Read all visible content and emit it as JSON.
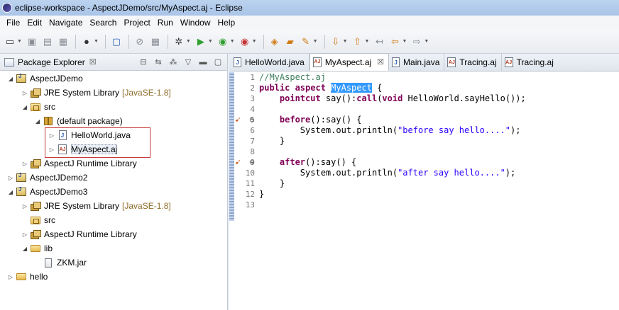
{
  "window": {
    "title": "eclipse-workspace - AspectJDemo/src/MyAspect.aj - Eclipse"
  },
  "menu": {
    "items": [
      "File",
      "Edit",
      "Navigate",
      "Search",
      "Project",
      "Run",
      "Window",
      "Help"
    ]
  },
  "package_explorer": {
    "title": "Package Explorer",
    "close": "☒",
    "tree": [
      {
        "label": "AspectJDemo",
        "decor": "",
        "indent": 0,
        "twisty": "◢",
        "icon": "project"
      },
      {
        "label": "JRE System Library",
        "decor": "[JavaSE-1.8]",
        "indent": 1,
        "twisty": "▷",
        "icon": "library"
      },
      {
        "label": "src",
        "decor": "",
        "indent": 1,
        "twisty": "◢",
        "icon": "srcfolder"
      },
      {
        "label": "(default package)",
        "decor": "",
        "indent": 2,
        "twisty": "◢",
        "icon": "package"
      },
      {
        "label": "HelloWorld.java",
        "decor": "",
        "indent": 3,
        "twisty": "▷",
        "icon": "javafile"
      },
      {
        "label": "MyAspect.aj",
        "decor": "",
        "indent": 3,
        "twisty": "▷",
        "icon": "ajfile"
      },
      {
        "label": "AspectJ Runtime Library",
        "decor": "",
        "indent": 1,
        "twisty": "▷",
        "icon": "library"
      },
      {
        "label": "AspectJDemo2",
        "decor": "",
        "indent": 0,
        "twisty": "▷",
        "icon": "project"
      },
      {
        "label": "AspectJDemo3",
        "decor": "",
        "indent": 0,
        "twisty": "◢",
        "icon": "project"
      },
      {
        "label": "JRE System Library",
        "decor": "[JavaSE-1.8]",
        "indent": 1,
        "twisty": "▷",
        "icon": "library"
      },
      {
        "label": "src",
        "decor": "",
        "indent": 1,
        "twisty": "",
        "icon": "srcfolder"
      },
      {
        "label": "AspectJ Runtime Library",
        "decor": "",
        "indent": 1,
        "twisty": "▷",
        "icon": "library"
      },
      {
        "label": "lib",
        "decor": "",
        "indent": 1,
        "twisty": "◢",
        "icon": "folder"
      },
      {
        "label": "ZKM.jar",
        "decor": "",
        "indent": 2,
        "twisty": "",
        "icon": "jar"
      },
      {
        "label": "hello",
        "decor": "",
        "indent": 0,
        "twisty": "▷",
        "icon": "project"
      }
    ]
  },
  "editor": {
    "tabs": [
      {
        "label": "HelloWorld.java",
        "icon": "J",
        "active": false,
        "close": ""
      },
      {
        "label": "MyAspect.aj",
        "icon": "AJ",
        "active": true,
        "close": "☒"
      },
      {
        "label": "Main.java",
        "icon": "J",
        "active": false,
        "close": ""
      },
      {
        "label": "Tracing.aj",
        "icon": "AJ",
        "active": false,
        "close": ""
      },
      {
        "label": "Tracing.aj",
        "icon": "AJ",
        "active": false,
        "close": ""
      }
    ],
    "line_numbers": [
      "1",
      "2",
      "3",
      "4",
      "5",
      "6",
      "7",
      "8",
      "9",
      "10",
      "11",
      "12",
      "13"
    ],
    "fold_markers": [
      "5⊖",
      "9⊖"
    ],
    "code": {
      "l1": "//MyAspect.aj",
      "l2_kw": "public aspect ",
      "l2_sel": "MyAspect",
      "l2_rest": " {",
      "l3_indent": "    ",
      "l3_kw": "pointcut",
      "l3_a": " say():",
      "l3_kw2": "call",
      "l3_b": "(",
      "l3_kw3": "void",
      "l3_c": " HelloWorld.sayHello());",
      "l4": "",
      "l5_indent": "    ",
      "l5_kw": "before",
      "l5_rest": "():say() {",
      "l6_a": "        System.out.println(",
      "l6_str": "\"before say hello....\"",
      "l6_b": ");",
      "l7": "    }",
      "l8": "",
      "l9_indent": "    ",
      "l9_kw": "after",
      "l9_rest": "():say() {",
      "l10_a": "        System.out.println(",
      "l10_str": "\"after say hello....\"",
      "l10_b": ");",
      "l11": "    }",
      "l12": "}",
      "l13": ""
    }
  }
}
